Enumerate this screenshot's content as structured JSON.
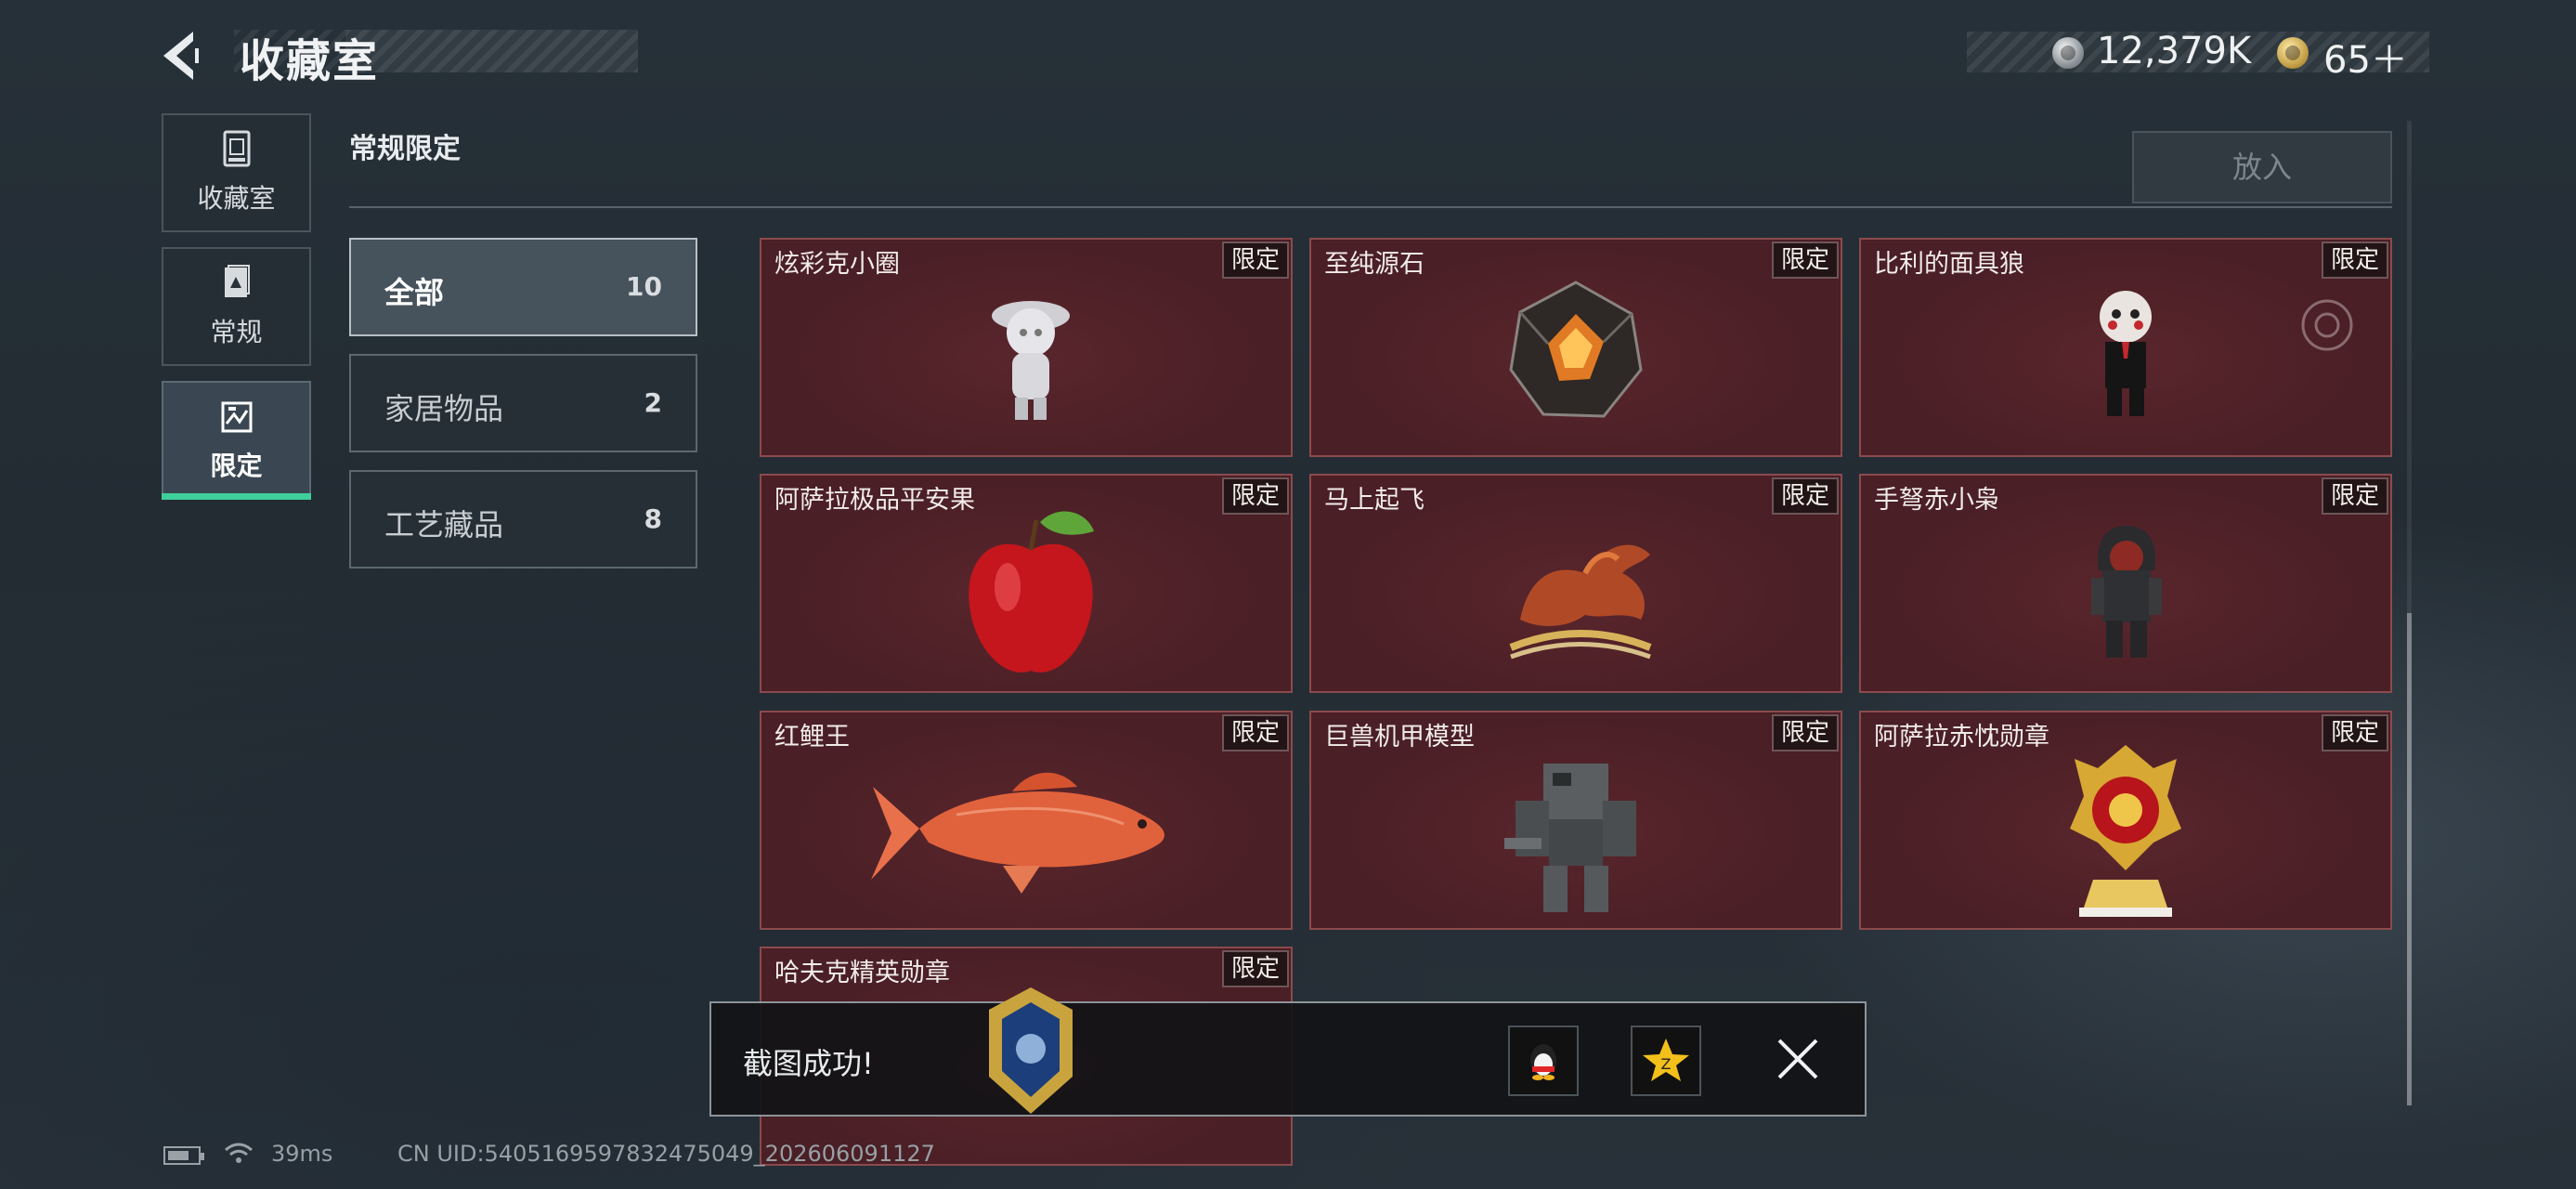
{
  "header": {
    "title": "收藏室",
    "currency": [
      {
        "icon": "silver-coin-icon",
        "value": "12,379K"
      },
      {
        "icon": "gold-coin-icon",
        "value": "65＋"
      }
    ]
  },
  "nav": [
    {
      "label": "收藏室",
      "icon": "trash-bin-icon"
    },
    {
      "label": "常规",
      "icon": "document-icon"
    },
    {
      "label": "限定",
      "icon": "limited-icon",
      "active": true
    }
  ],
  "section": {
    "title": "常规限定",
    "place_button": "放入"
  },
  "categories": [
    {
      "name": "全部",
      "count": "10",
      "active": true
    },
    {
      "name": "家居物品",
      "count": "2"
    },
    {
      "name": "工艺藏品",
      "count": "8"
    }
  ],
  "items": [
    {
      "name": "炫彩克小圈",
      "tag": "限定",
      "icon": "figurine-icon"
    },
    {
      "name": "至纯源石",
      "tag": "限定",
      "icon": "crystal-stone-icon"
    },
    {
      "name": "比利的面具狼",
      "tag": "限定",
      "icon": "puppet-figure-icon"
    },
    {
      "name": "阿萨拉极品平安果",
      "tag": "限定",
      "icon": "apple-icon"
    },
    {
      "name": "马上起飞",
      "tag": "限定",
      "icon": "horse-statue-icon"
    },
    {
      "name": "手弩赤小枭",
      "tag": "限定",
      "icon": "hooded-figure-icon"
    },
    {
      "name": "红鲤王",
      "tag": "限定",
      "icon": "carp-fish-icon"
    },
    {
      "name": "巨兽机甲模型",
      "tag": "限定",
      "icon": "mech-model-icon"
    },
    {
      "name": "阿萨拉赤忱勋章",
      "tag": "限定",
      "icon": "gold-medal-icon"
    },
    {
      "name": "哈夫克精英勋章",
      "tag": "限定",
      "icon": "badge-icon"
    }
  ],
  "toast": {
    "text": "截图成功!",
    "share": [
      "qq-share-icon",
      "qzone-share-icon"
    ]
  },
  "status": {
    "ping": "39ms",
    "uid": "CN UID:5405169597832475049_202606091127"
  },
  "colors": {
    "accent": "#3ecf9a",
    "card_bg": "#4a1f25",
    "card_border": "#8b4a4d"
  }
}
